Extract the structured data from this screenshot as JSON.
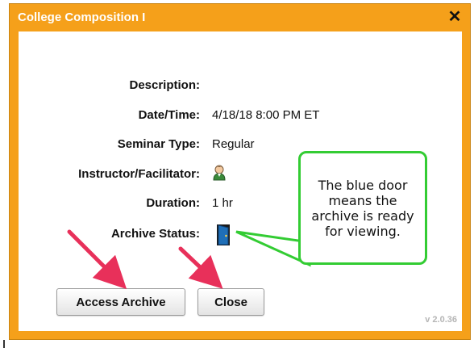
{
  "dialog": {
    "title": "College Composition I",
    "close_glyph": "✕"
  },
  "fields": [
    {
      "label": "Description:",
      "value": ""
    },
    {
      "label": "Date/Time:",
      "value": "4/18/18 8:00 PM ET"
    },
    {
      "label": "Seminar Type:",
      "value": "Regular"
    },
    {
      "label": "Instructor/Facilitator:",
      "icon": "person-icon"
    },
    {
      "label": "Duration:",
      "value": "1 hr"
    },
    {
      "label": "Archive Status:",
      "icon": "blue-door-icon"
    }
  ],
  "buttons": {
    "access_archive": "Access Archive",
    "close": "Close"
  },
  "version": "v 2.0.36",
  "callout": {
    "text": "The blue door means the archive is ready for viewing."
  },
  "colors": {
    "frame": "#f5a01a",
    "callout_border": "#33cc33",
    "arrow": "#e8305a",
    "door": "#1f6fb8"
  }
}
